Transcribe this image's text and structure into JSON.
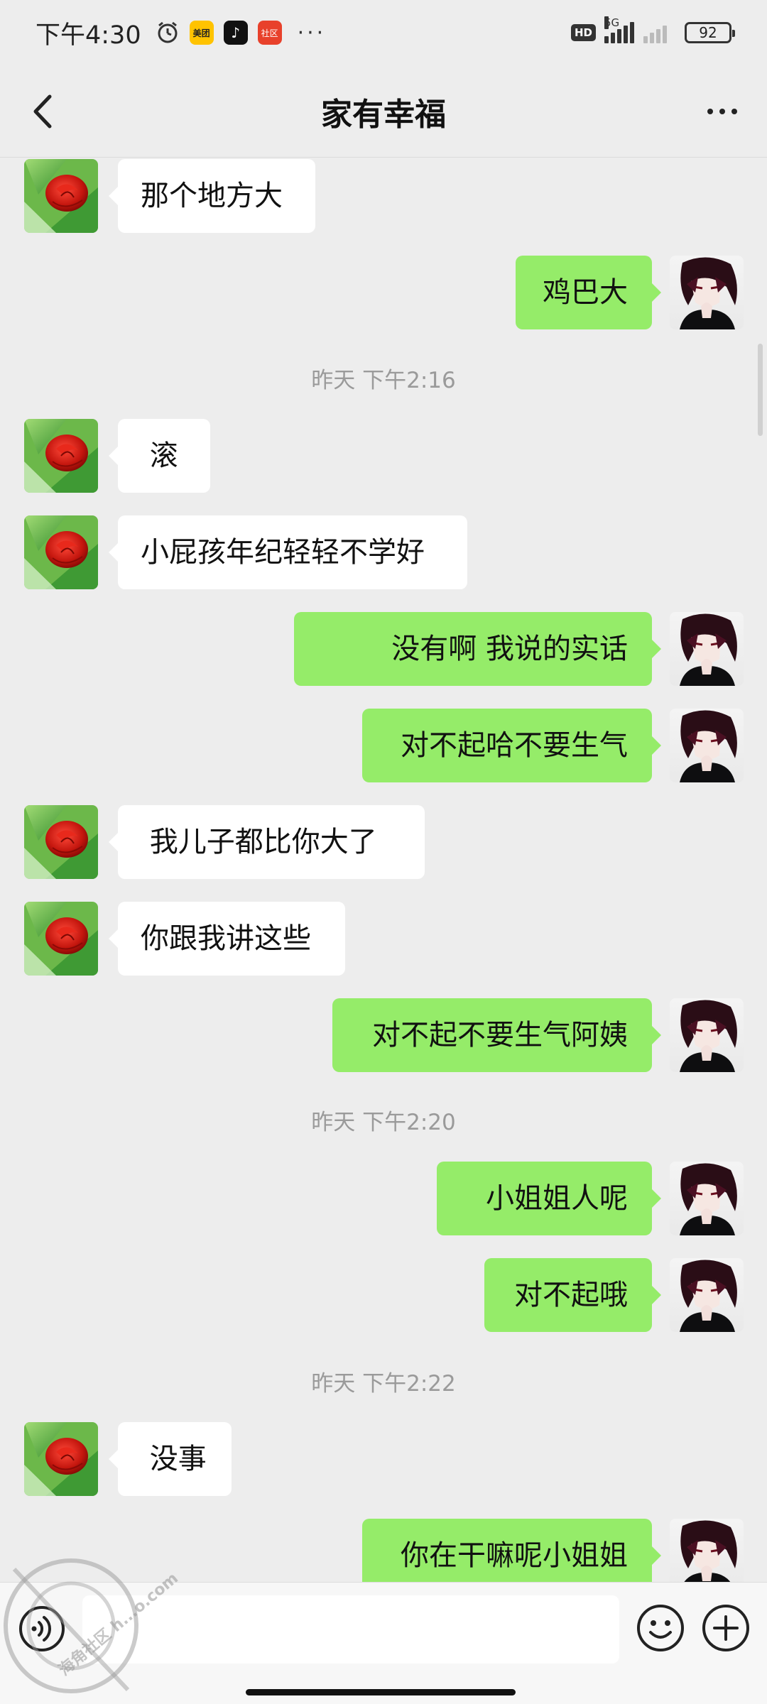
{
  "status_bar": {
    "time": "下午4:30",
    "notification_icons": [
      "alarm-icon",
      "meituan-app-icon",
      "tiktok-app-icon",
      "red-app-icon"
    ],
    "meituan_label": "美团",
    "red_app_label": "社区",
    "overflow": "···",
    "hd_label": "HD",
    "network": "5G",
    "battery": "92"
  },
  "header": {
    "title": "家有幸福",
    "back_icon": "chevron-left-icon",
    "more_icon": "more-dots-icon"
  },
  "colors": {
    "background": "#ededed",
    "incoming_bubble": "#ffffff",
    "outgoing_bubble": "#95ec69",
    "timestamp_text": "#9a9a9a"
  },
  "messages": [
    {
      "type": "incoming",
      "text": "那个地方大"
    },
    {
      "type": "outgoing",
      "text": "鸡巴大"
    },
    {
      "type": "time",
      "text": "昨天 下午2:16"
    },
    {
      "type": "incoming",
      "text": " 滚"
    },
    {
      "type": "incoming",
      "text": "小屁孩年纪轻轻不学好"
    },
    {
      "type": "outgoing",
      "text": "没有啊 我说的实话"
    },
    {
      "type": "outgoing",
      "text": "对不起哈不要生气"
    },
    {
      "type": "incoming",
      "text": " 我儿子都比你大了"
    },
    {
      "type": "incoming",
      "text": "你跟我讲这些"
    },
    {
      "type": "outgoing",
      "text": "对不起不要生气阿姨"
    },
    {
      "type": "time",
      "text": "昨天 下午2:20"
    },
    {
      "type": "outgoing",
      "text": "小姐姐人呢"
    },
    {
      "type": "outgoing",
      "text": "对不起哦"
    },
    {
      "type": "time",
      "text": "昨天 下午2:22"
    },
    {
      "type": "incoming",
      "text": " 没事"
    },
    {
      "type": "outgoing",
      "text": "你在干嘛呢小姐姐"
    }
  ],
  "input_bar": {
    "voice_icon": "voice-icon",
    "input_value": "",
    "emoji_icon": "emoji-icon",
    "plus_icon": "plus-icon"
  },
  "watermark": {
    "text": "海角社区",
    "domain_fragment": "h...o.com"
  }
}
